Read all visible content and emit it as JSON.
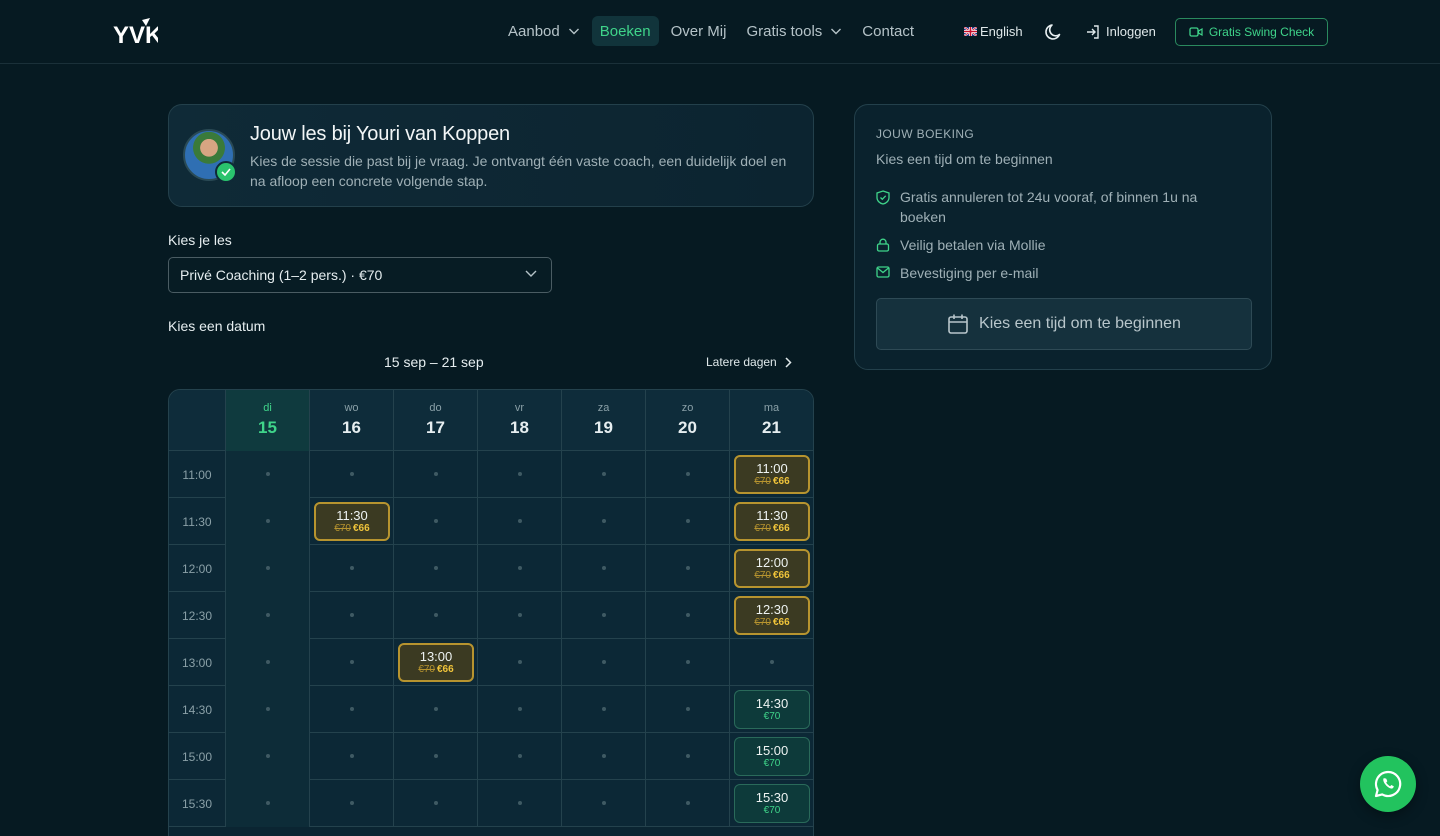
{
  "header": {
    "logo_text": "YVK",
    "nav": [
      {
        "label": "Aanbod",
        "dropdown": true,
        "active": false
      },
      {
        "label": "Boeken",
        "dropdown": false,
        "active": true
      },
      {
        "label": "Over Mij",
        "dropdown": false,
        "active": false
      },
      {
        "label": "Gratis tools",
        "dropdown": true,
        "active": false
      },
      {
        "label": "Contact",
        "dropdown": false,
        "active": false
      }
    ],
    "language": "English",
    "login_label": "Inloggen",
    "cta_label": "Gratis Swing Check"
  },
  "coach": {
    "title": "Jouw les bij Youri van Koppen",
    "description": "Kies de sessie die past bij je vraag. Je ontvangt één vaste coach, een duidelijk doel en na afloop een concrete volgende stap."
  },
  "lesson": {
    "label": "Kies je les",
    "selected": "Privé Coaching (1–2 pers.) · €70"
  },
  "date": {
    "label": "Kies een datum",
    "range": "15 sep – 21 sep",
    "later_label": "Latere dagen"
  },
  "calendar": {
    "days": [
      {
        "name": "di",
        "num": "15",
        "today": true
      },
      {
        "name": "wo",
        "num": "16",
        "today": false
      },
      {
        "name": "do",
        "num": "17",
        "today": false
      },
      {
        "name": "vr",
        "num": "18",
        "today": false
      },
      {
        "name": "za",
        "num": "19",
        "today": false
      },
      {
        "name": "zo",
        "num": "20",
        "today": false
      },
      {
        "name": "ma",
        "num": "21",
        "today": false
      }
    ],
    "rows": [
      {
        "time": "11:00",
        "slots": [
          null,
          null,
          null,
          null,
          null,
          null,
          {
            "type": "promo",
            "old": "€70",
            "new": "€66"
          }
        ]
      },
      {
        "time": "11:30",
        "slots": [
          null,
          {
            "type": "promo",
            "old": "€70",
            "new": "€66"
          },
          null,
          null,
          null,
          null,
          {
            "type": "promo",
            "old": "€70",
            "new": "€66"
          }
        ]
      },
      {
        "time": "12:00",
        "slots": [
          null,
          null,
          null,
          null,
          null,
          null,
          {
            "type": "promo",
            "old": "€70",
            "new": "€66"
          }
        ]
      },
      {
        "time": "12:30",
        "slots": [
          null,
          null,
          null,
          null,
          null,
          null,
          {
            "type": "promo",
            "old": "€70",
            "new": "€66"
          }
        ]
      },
      {
        "time": "13:00",
        "slots": [
          null,
          null,
          {
            "type": "promo",
            "old": "€70",
            "new": "€66"
          },
          null,
          null,
          null,
          null
        ]
      },
      {
        "time": "14:30",
        "slots": [
          null,
          null,
          null,
          null,
          null,
          null,
          {
            "type": "normal",
            "price": "€70"
          }
        ]
      },
      {
        "time": "15:00",
        "slots": [
          null,
          null,
          null,
          null,
          null,
          null,
          {
            "type": "normal",
            "price": "€70"
          }
        ]
      },
      {
        "time": "15:30",
        "slots": [
          null,
          null,
          null,
          null,
          null,
          null,
          {
            "type": "normal",
            "price": "€70"
          }
        ]
      }
    ]
  },
  "booking": {
    "title": "JOUW BOEKING",
    "subtitle": "Kies een tijd om te beginnen",
    "features": [
      {
        "icon": "shield-check-icon",
        "text": "Gratis annuleren tot 24u vooraf, of binnen 1u na boeken"
      },
      {
        "icon": "lock-icon",
        "text": "Veilig betalen via Mollie"
      },
      {
        "icon": "mail-check-icon",
        "text": "Bevestiging per e-mail"
      }
    ],
    "button_label": "Kies een tijd om te beginnen"
  },
  "colors": {
    "accent": "#3fd48a",
    "promo_border": "#b7942f",
    "promo_price": "#f0c43a",
    "background": "#061a22"
  }
}
